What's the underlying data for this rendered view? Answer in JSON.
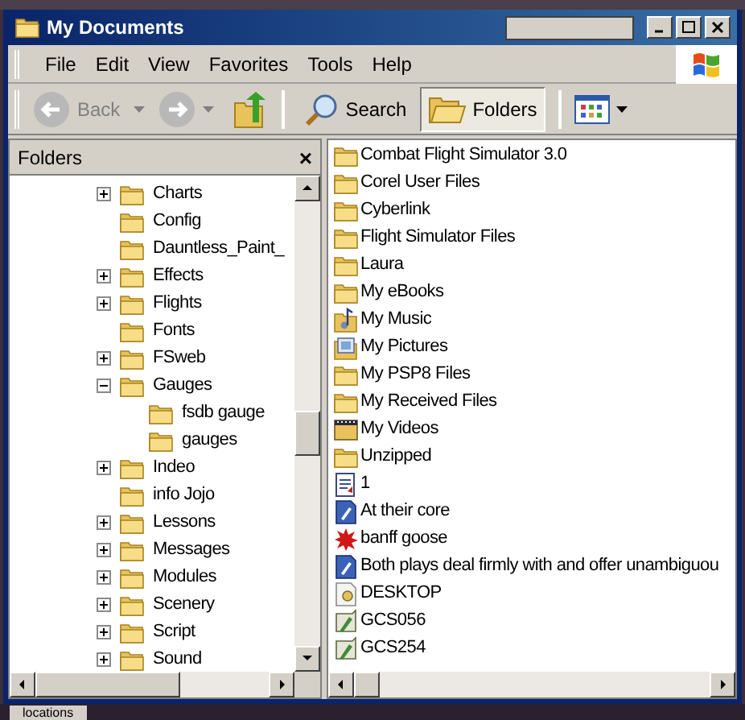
{
  "window": {
    "title": "My Documents"
  },
  "menu": [
    "File",
    "Edit",
    "View",
    "Favorites",
    "Tools",
    "Help"
  ],
  "toolbar": {
    "back": "Back",
    "search": "Search",
    "folders": {
      "label": "Folders",
      "selected": true
    }
  },
  "folders_pane": {
    "title": "Folders",
    "close": "×",
    "items": [
      {
        "name": "Charts",
        "expanded": false
      },
      {
        "name": "Config"
      },
      {
        "name": "Dauntless_Paint_"
      },
      {
        "name": "Effects",
        "expanded": false
      },
      {
        "name": "Flights",
        "expanded": false
      },
      {
        "name": "Fonts"
      },
      {
        "name": "FSweb",
        "expanded": false
      },
      {
        "name": "Gauges",
        "expanded": true,
        "children": [
          {
            "name": "fsdb gauge"
          },
          {
            "name": "gauges"
          }
        ]
      },
      {
        "name": "Indeo",
        "expanded": false
      },
      {
        "name": "info Jojo"
      },
      {
        "name": "Lessons",
        "expanded": false
      },
      {
        "name": "Messages",
        "expanded": false
      },
      {
        "name": "Modules",
        "expanded": false
      },
      {
        "name": "Scenery",
        "expanded": false
      },
      {
        "name": "Script",
        "expanded": false
      },
      {
        "name": "Sound",
        "expanded": false
      }
    ]
  },
  "files": [
    {
      "name": "Combat Flight Simulator 3.0",
      "kind": "folder"
    },
    {
      "name": "Corel User Files",
      "kind": "folder"
    },
    {
      "name": "Cyberlink",
      "kind": "folder"
    },
    {
      "name": "Flight Simulator Files",
      "kind": "folder"
    },
    {
      "name": "Laura",
      "kind": "folder"
    },
    {
      "name": "My eBooks",
      "kind": "folder"
    },
    {
      "name": "My Music",
      "kind": "music"
    },
    {
      "name": "My Pictures",
      "kind": "pictures"
    },
    {
      "name": "My PSP8 Files",
      "kind": "folder"
    },
    {
      "name": "My Received Files",
      "kind": "folder"
    },
    {
      "name": "My Videos",
      "kind": "videos"
    },
    {
      "name": "Unzipped",
      "kind": "folder"
    },
    {
      "name": "1",
      "kind": "text"
    },
    {
      "name": "At their core",
      "kind": "document"
    },
    {
      "name": "banff goose",
      "kind": "splat"
    },
    {
      "name": "Both plays deal firmly with and offer unambiguou",
      "kind": "document"
    },
    {
      "name": "DESKTOP",
      "kind": "settings"
    },
    {
      "name": "GCS056",
      "kind": "image"
    },
    {
      "name": "GCS254",
      "kind": "image"
    }
  ],
  "taskbar": {
    "tab": "locations"
  }
}
